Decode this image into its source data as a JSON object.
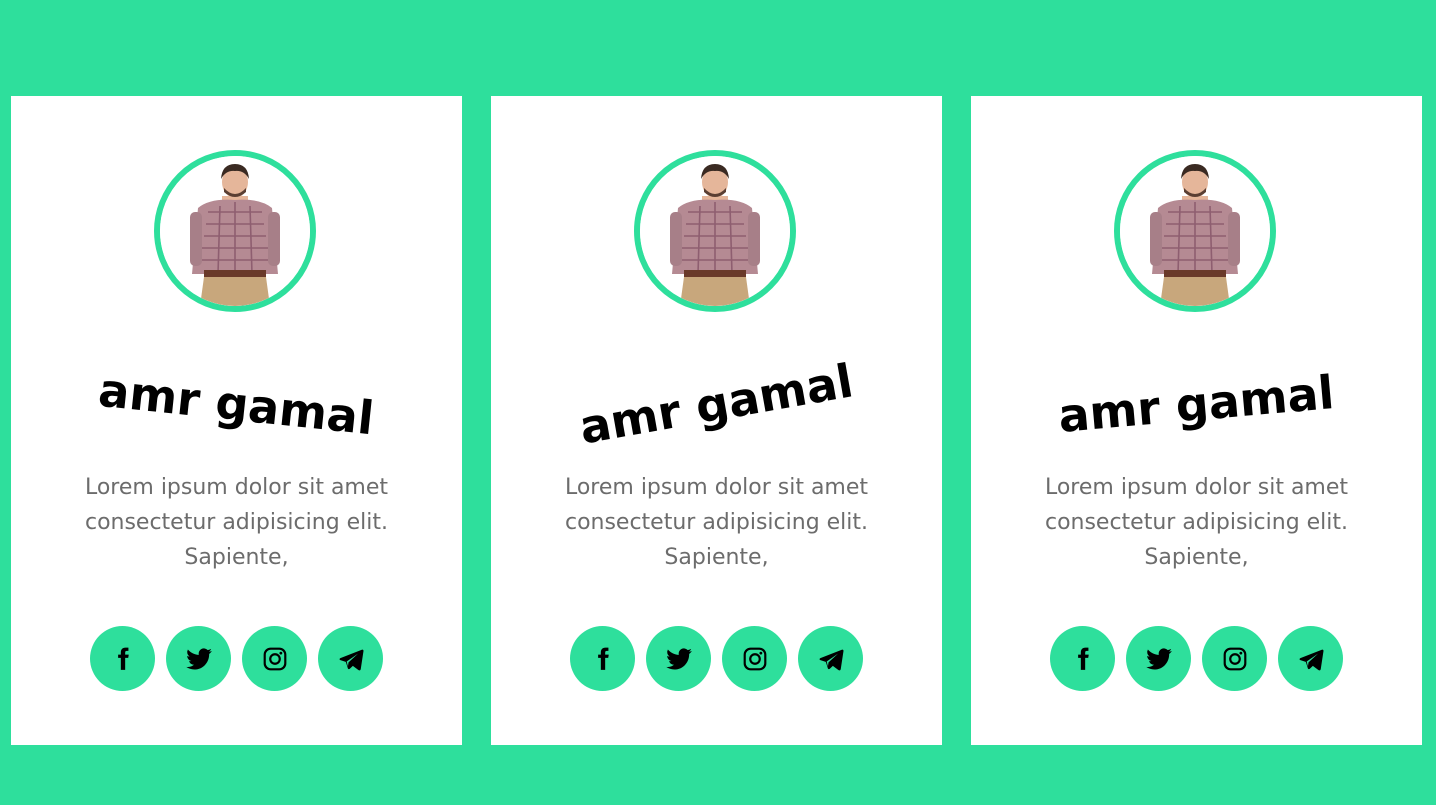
{
  "colors": {
    "background": "#2edf9c",
    "accent": "#2edf9c",
    "card": "#ffffff",
    "name_text": "#000000",
    "body_text": "#6c6c6c"
  },
  "cards": [
    {
      "name": "amr gamal",
      "description": "Lorem ipsum dolor sit amet consectetur adipisicing elit. Sapiente,",
      "socials": [
        "facebook-icon",
        "twitter-icon",
        "instagram-icon",
        "telegram-icon"
      ]
    },
    {
      "name": "amr gamal",
      "description": "Lorem ipsum dolor sit amet consectetur adipisicing elit. Sapiente,",
      "socials": [
        "facebook-icon",
        "twitter-icon",
        "instagram-icon",
        "telegram-icon"
      ]
    },
    {
      "name": "amr gamal",
      "description": "Lorem ipsum dolor sit amet consectetur adipisicing elit. Sapiente,",
      "socials": [
        "facebook-icon",
        "twitter-icon",
        "instagram-icon",
        "telegram-icon"
      ]
    }
  ]
}
